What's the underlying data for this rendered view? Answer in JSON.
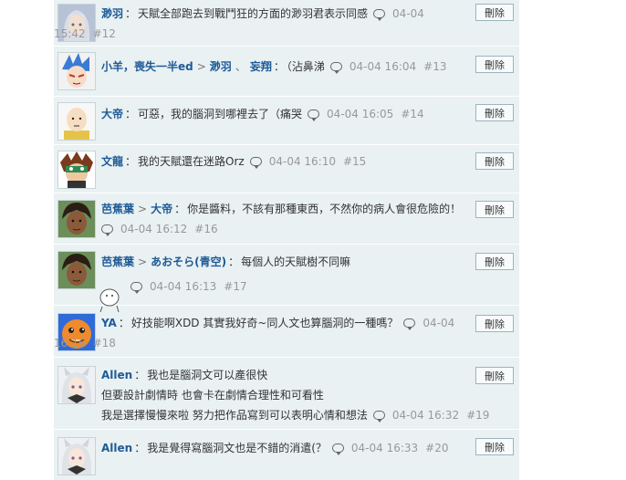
{
  "delete_label": "刪除",
  "comments": [
    {
      "name": "渺羽",
      "targets": [],
      "text": "天賦全部跑去到戰鬥狂的方面的渺羽君表示同感",
      "date": "04-04",
      "time": "15:42",
      "seq": "#12",
      "avatar": "silver-hair-avatar"
    },
    {
      "name": "小羊，喪失一半ed",
      "targets": [
        "渺羽",
        "妄翔"
      ],
      "text": "（沾鼻涕",
      "date": "04-04 16:04",
      "seq": "#13",
      "avatar": "blue-hair-avatar"
    },
    {
      "name": "大帝",
      "targets": [],
      "text": "可惡，我的腦洞到哪裡去了（痛哭",
      "date": "04-04 16:05",
      "seq": "#14",
      "avatar": "bald-hero-avatar"
    },
    {
      "name": "文龍",
      "targets": [],
      "text": "我的天賦還在迷路Orz",
      "date": "04-04 16:10",
      "seq": "#15",
      "avatar": "masked-avatar"
    },
    {
      "name": "芭蕉葉",
      "targets": [
        "大帝"
      ],
      "text": "你是醬料，不該有那種東西，不然你的病人會很危險的！",
      "date": "04-04 16:12",
      "seq": "#16",
      "avatar": "dark-hair-avatar"
    },
    {
      "name": "芭蕉葉",
      "targets": [
        "あおそら(青空)"
      ],
      "text": "每個人的天賦樹不同嘛",
      "date": "04-04 16:13",
      "seq": "#17",
      "avatar": "dark-hair-avatar"
    },
    {
      "name": "YA",
      "targets": [],
      "text": "好技能啊XDD 其實我好奇~同人文也算腦洞的一種嗎？",
      "date": "04-04",
      "time": "16:16",
      "seq": "#18",
      "avatar": "charmander-avatar"
    },
    {
      "name": "Allen",
      "targets": [],
      "lines": [
        "我也是腦洞文可以產很快",
        "但要設計劇情時 也會卡在劇情合理性和可看性",
        "我是選擇慢慢來啦 努力把作品寫到可以表明心情和想法"
      ],
      "date": "04-04 16:32",
      "seq": "#19",
      "avatar": "white-hair-avatar"
    },
    {
      "name": "Allen",
      "targets": [],
      "text": "我是覺得寫腦洞文也是不錯的消遣(？",
      "date": "04-04 16:33",
      "seq": "#20",
      "avatar": "white-hair-avatar"
    }
  ]
}
